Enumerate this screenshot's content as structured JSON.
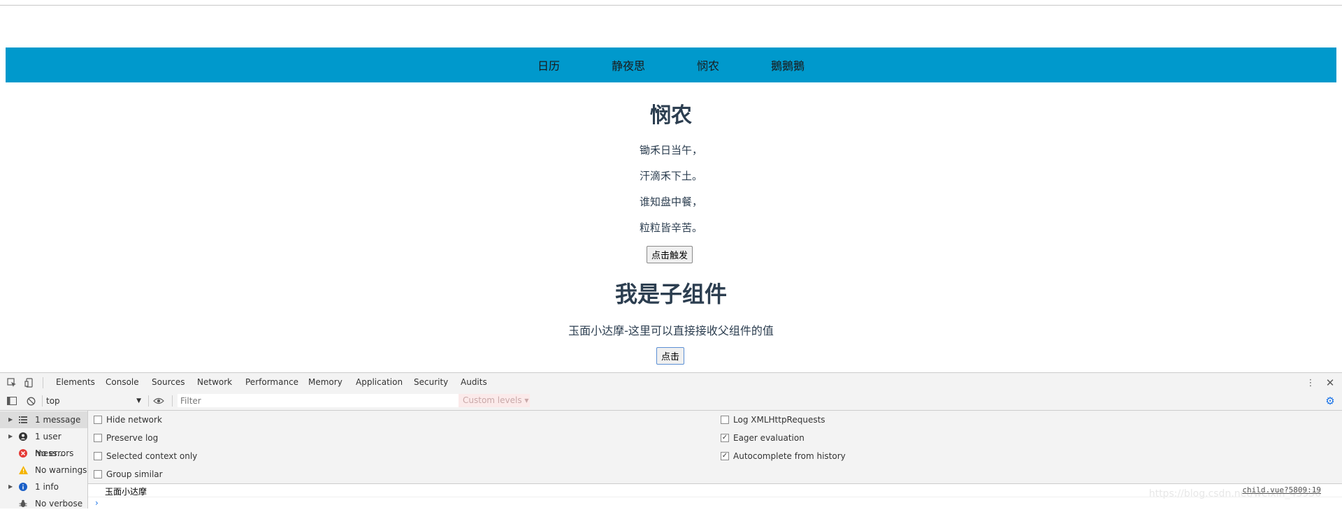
{
  "nav": {
    "items": [
      "日历",
      "静夜思",
      "悯农",
      "鵝鵝鵝"
    ]
  },
  "poem": {
    "title": "悯农",
    "lines": [
      "锄禾日当午，",
      "汗滴禾下土。",
      "谁知盘中餐，",
      "粒粒皆辛苦。"
    ],
    "button_label": "点击触发"
  },
  "child": {
    "title": "我是子组件",
    "text": "玉面小达摩-这里可以直接接收父组件的值",
    "button_label": "点击"
  },
  "devtools": {
    "tabs": [
      "Elements",
      "Console",
      "Sources",
      "Network",
      "Performance",
      "Memory",
      "Application",
      "Security",
      "Audits"
    ],
    "active_tab": "Console",
    "context": "top",
    "filter_placeholder": "Filter",
    "levels_label": "Custom levels ▾",
    "sidebar": [
      {
        "label": "1 message",
        "icon": "list-icon",
        "color": "#555555"
      },
      {
        "label": "1 user mess...",
        "icon": "user-icon",
        "color": "#333333"
      },
      {
        "label": "No errors",
        "icon": "error-icon",
        "color": "#e53935"
      },
      {
        "label": "No warnings",
        "icon": "warning-icon",
        "color": "#f4b400"
      },
      {
        "label": "1 info",
        "icon": "info-icon",
        "color": "#1a5fc7"
      },
      {
        "label": "No verbose",
        "icon": "bug-icon",
        "color": "#555555"
      }
    ],
    "settings_left": [
      {
        "label": "Hide network",
        "checked": false
      },
      {
        "label": "Preserve log",
        "checked": false
      },
      {
        "label": "Selected context only",
        "checked": false
      },
      {
        "label": "Group similar",
        "checked": false
      }
    ],
    "settings_right": [
      {
        "label": "Log XMLHttpRequests",
        "checked": false
      },
      {
        "label": "Eager evaluation",
        "checked": true
      },
      {
        "label": "Autocomplete from history",
        "checked": true
      }
    ],
    "message": {
      "text": "玉面小达摩",
      "source": "child.vue?5809:19"
    },
    "watermark": "https://blog.csdn.net/weixin_43936"
  }
}
